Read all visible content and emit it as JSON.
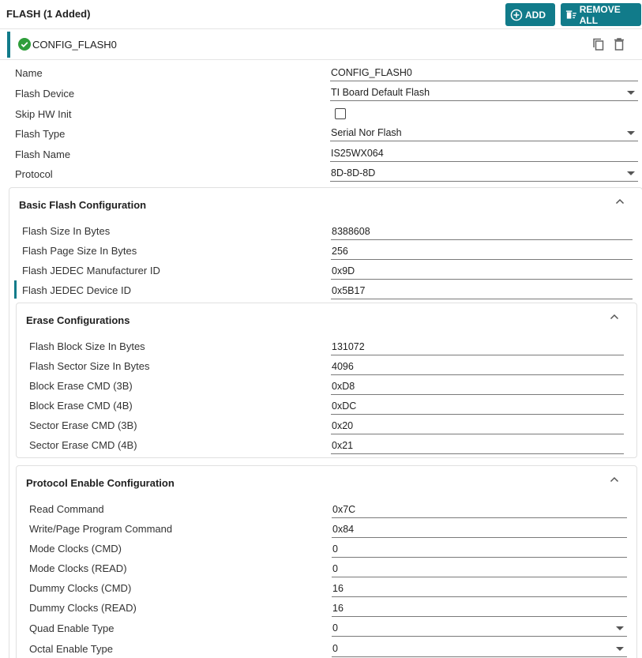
{
  "header": {
    "title": "FLASH (1 Added)",
    "add_label": "ADD",
    "remove_all_label": "REMOVE ALL"
  },
  "config": {
    "name": "CONFIG_FLASH0",
    "icons": [
      "check-circle-icon",
      "copy-icon",
      "delete-icon"
    ]
  },
  "general": {
    "name": {
      "label": "Name",
      "value": "CONFIG_FLASH0"
    },
    "flash_device": {
      "label": "Flash Device",
      "value": "TI Board Default Flash"
    },
    "skip_hw_init": {
      "label": "Skip HW Init",
      "checked": false
    },
    "flash_type": {
      "label": "Flash Type",
      "value": "Serial Nor Flash"
    },
    "flash_name": {
      "label": "Flash Name",
      "value": "IS25WX064"
    },
    "protocol": {
      "label": "Protocol",
      "value": "8D-8D-8D"
    }
  },
  "basic": {
    "title": "Basic Flash Configuration",
    "size_bytes": {
      "label": "Flash Size In Bytes",
      "value": "8388608"
    },
    "page_size": {
      "label": "Flash Page Size In Bytes",
      "value": "256"
    },
    "jedec_mfr": {
      "label": "Flash JEDEC Manufacturer ID",
      "value": "0x9D"
    },
    "jedec_dev": {
      "label": "Flash JEDEC Device ID",
      "value": "0x5B17"
    }
  },
  "erase": {
    "title": "Erase Configurations",
    "block_size": {
      "label": "Flash Block Size In Bytes",
      "value": "131072"
    },
    "sector_size": {
      "label": "Flash Sector Size In Bytes",
      "value": "4096"
    },
    "block_cmd_3b": {
      "label": "Block Erase CMD (3B)",
      "value": "0xD8"
    },
    "block_cmd_4b": {
      "label": "Block Erase CMD (4B)",
      "value": "0xDC"
    },
    "sector_cmd_3b": {
      "label": "Sector Erase CMD (3B)",
      "value": "0x20"
    },
    "sector_cmd_4b": {
      "label": "Sector Erase CMD (4B)",
      "value": "0x21"
    }
  },
  "protocol_cfg": {
    "title": "Protocol Enable Configuration",
    "read_cmd": {
      "label": "Read Command",
      "value": "0x7C"
    },
    "write_cmd": {
      "label": "Write/Page Program Command",
      "value": "0x84"
    },
    "mode_clk_cmd": {
      "label": "Mode Clocks (CMD)",
      "value": "0"
    },
    "mode_clk_read": {
      "label": "Mode Clocks (READ)",
      "value": "0"
    },
    "dummy_clk_cmd": {
      "label": "Dummy Clocks (CMD)",
      "value": "16"
    },
    "dummy_clk_read": {
      "label": "Dummy Clocks (READ)",
      "value": "16"
    },
    "quad_enable": {
      "label": "Quad Enable Type",
      "value": "0"
    },
    "octal_enable": {
      "label": "Octal Enable Type",
      "value": "0"
    }
  },
  "colors": {
    "accent": "#117b8a",
    "success": "#2e9e3a"
  }
}
